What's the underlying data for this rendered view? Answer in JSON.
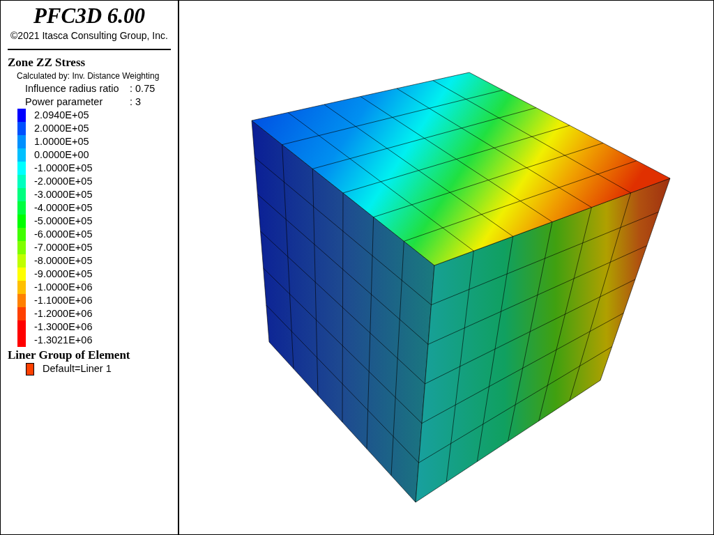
{
  "title": "PFC3D 6.00",
  "copyright": "©2021 Itasca Consulting Group, Inc.",
  "contour_legend": {
    "title": "Zone ZZ Stress",
    "method": "Calculated by: Inv. Distance Weighting",
    "params": [
      {
        "label": "Influence radius ratio",
        "value": ": 0.75"
      },
      {
        "label": "Power parameter",
        "value": ": 3"
      }
    ],
    "items": [
      {
        "label": "2.0940E+05",
        "color": "#0000ff"
      },
      {
        "label": "2.0000E+05",
        "color": "#0050ff"
      },
      {
        "label": "1.0000E+05",
        "color": "#0090ff"
      },
      {
        "label": "0.0000E+00",
        "color": "#00c0ff"
      },
      {
        "label": "-1.0000E+05",
        "color": "#00ffff"
      },
      {
        "label": "-2.0000E+05",
        "color": "#00ffc0"
      },
      {
        "label": "-3.0000E+05",
        "color": "#00ff80"
      },
      {
        "label": "-4.0000E+05",
        "color": "#00ff40"
      },
      {
        "label": "-5.0000E+05",
        "color": "#00ff00"
      },
      {
        "label": "-6.0000E+05",
        "color": "#40ff00"
      },
      {
        "label": "-7.0000E+05",
        "color": "#80ff00"
      },
      {
        "label": "-8.0000E+05",
        "color": "#c0ff00"
      },
      {
        "label": "-9.0000E+05",
        "color": "#ffff00"
      },
      {
        "label": "-1.0000E+06",
        "color": "#ffc000"
      },
      {
        "label": "-1.1000E+06",
        "color": "#ff8000"
      },
      {
        "label": "-1.2000E+06",
        "color": "#ff4000"
      },
      {
        "label": "-1.3000E+06",
        "color": "#ff0000"
      },
      {
        "label": "-1.3021E+06",
        "color": "#ff0000"
      }
    ]
  },
  "group_legend": {
    "title": "Liner Group of Element",
    "items": [
      {
        "label": "Default=Liner 1",
        "color": "#ff4000"
      }
    ]
  }
}
